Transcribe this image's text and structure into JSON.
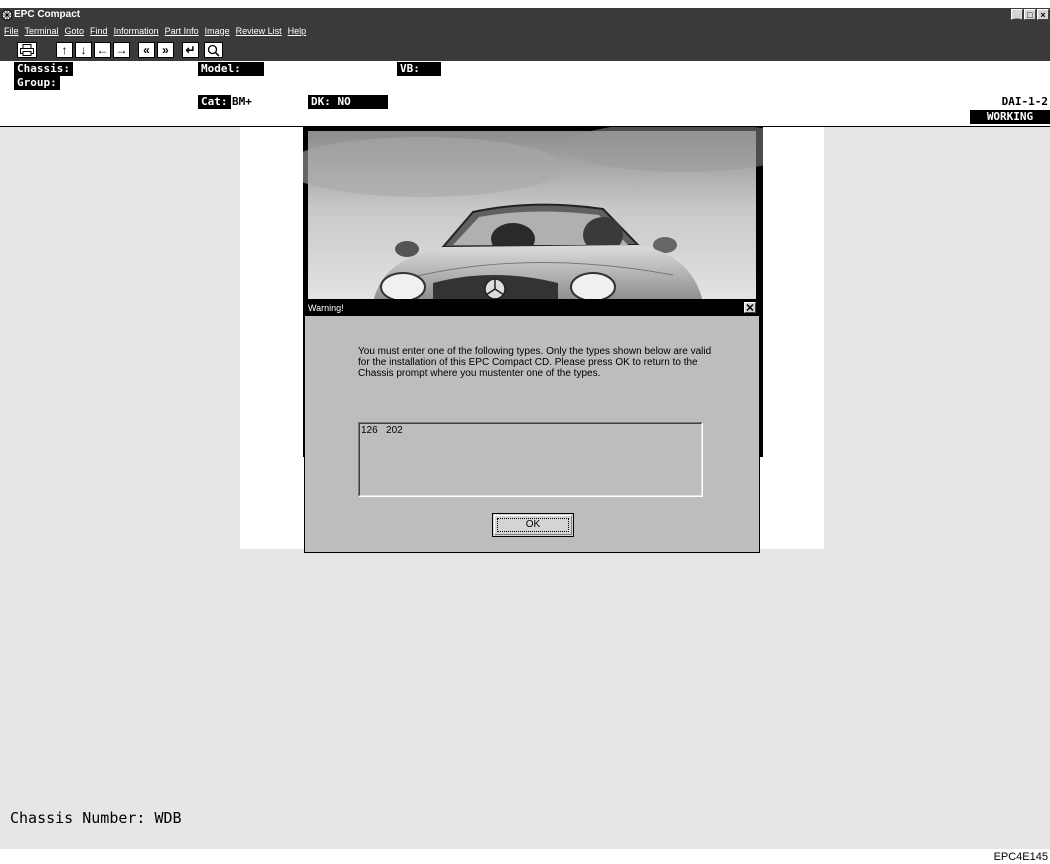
{
  "window": {
    "title": "EPC Compact",
    "app_icon": "globe-gear-icon",
    "controls": [
      "_",
      "□",
      "×"
    ]
  },
  "menu": [
    "File",
    "Terminal",
    "Goto",
    "Find",
    "Information",
    "Part Info",
    "Image",
    "Review List",
    "Help"
  ],
  "toolbar": {
    "buttons": [
      "print-icon",
      "arrow-up-icon",
      "arrow-down-icon",
      "arrow-left-icon",
      "arrow-right-icon",
      "page-back-icon",
      "page-forward-icon",
      "enter-icon",
      "magnifier-icon"
    ]
  },
  "header": {
    "chassis_label": "Chassis:",
    "group_label": "Group:",
    "model_label": "Model:",
    "vb_label": "VB:",
    "cat_label": "Cat:",
    "cat_value": "BM+",
    "dk_label": "DK: NO",
    "version": "DAI-1-2",
    "status": "WORKING"
  },
  "dialog": {
    "title": "Warning!",
    "message": "You must enter one of the following types. Only the types shown below are valid for the installation of this EPC Compact CD. Please press OK to return to the Chassis prompt where you mustenter one of the types.",
    "types": "126   202",
    "ok_label": "OK"
  },
  "status_line": "Chassis Number: WDB",
  "footer_code": "EPC4E145"
}
